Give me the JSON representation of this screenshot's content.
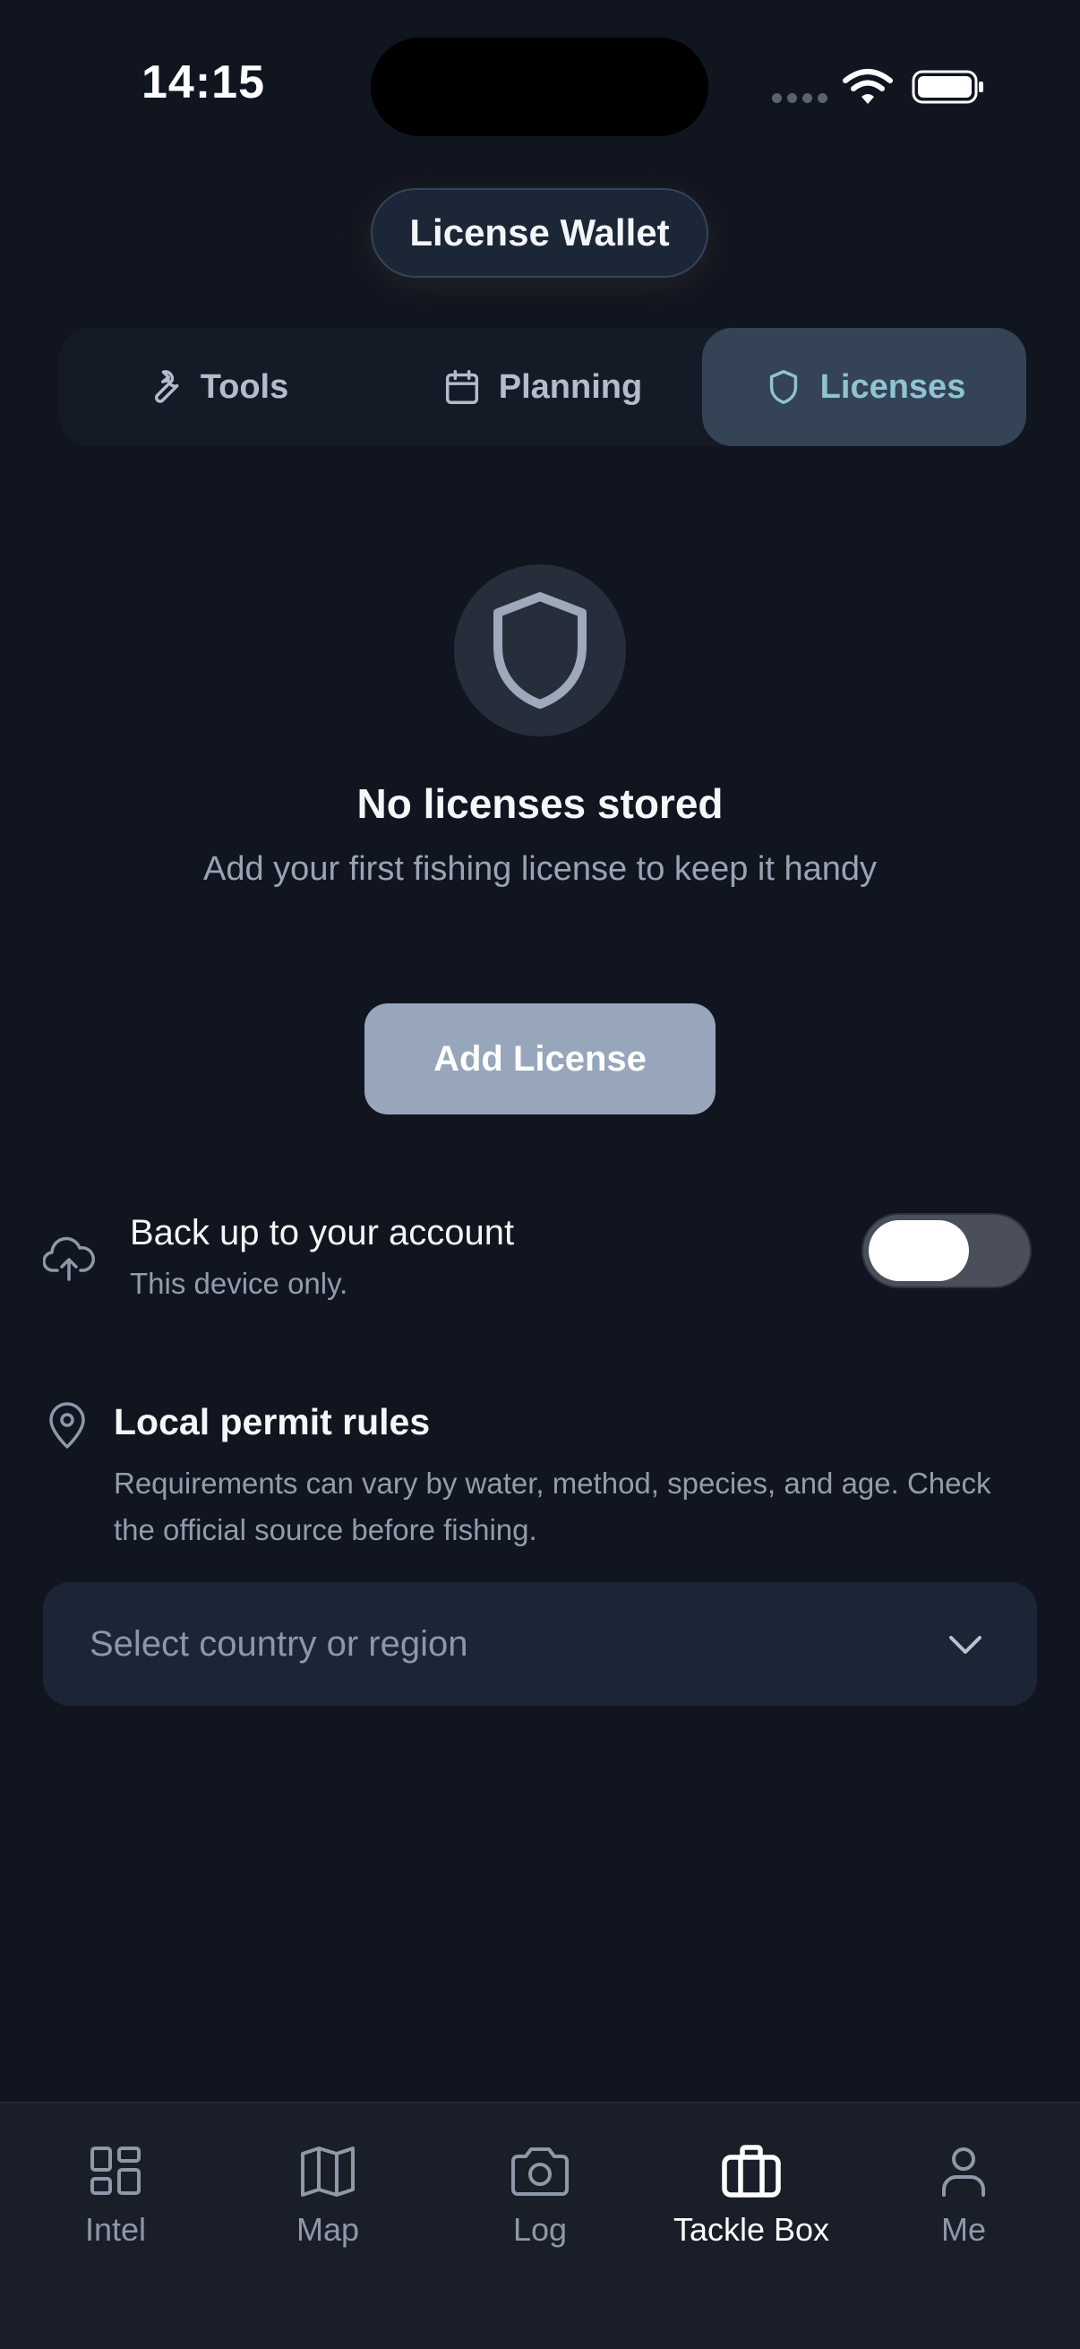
{
  "status_bar": {
    "time": "14:15"
  },
  "header": {
    "title": "License Wallet"
  },
  "tabs": [
    {
      "label": "Tools",
      "icon": "wrench-icon"
    },
    {
      "label": "Planning",
      "icon": "calendar-icon"
    },
    {
      "label": "Licenses",
      "icon": "shield-icon",
      "selected": true
    }
  ],
  "empty_state": {
    "icon": "shield-icon",
    "title": "No licenses stored",
    "subtitle": "Add your first fishing license to keep it handy",
    "button_label": "Add License"
  },
  "backup": {
    "icon": "cloud-upload-icon",
    "title": "Back up to your account",
    "subtitle": "This device only.",
    "enabled": false
  },
  "permit_rules": {
    "icon": "map-pin-icon",
    "title": "Local permit rules",
    "body": "Requirements can vary by water, method, species, and age. Check the official source before fishing.",
    "select_placeholder": "Select country or region"
  },
  "bottom_nav": [
    {
      "label": "Intel",
      "icon": "grid-icon"
    },
    {
      "label": "Map",
      "icon": "map-icon"
    },
    {
      "label": "Log",
      "icon": "camera-icon"
    },
    {
      "label": "Tackle Box",
      "icon": "briefcase-icon",
      "active": true
    },
    {
      "label": "Me",
      "icon": "person-icon"
    }
  ],
  "colors": {
    "background": "#111520",
    "accent_tab_text": "#8fc3d1",
    "selected_tab_bg": "#344356",
    "button_bg": "#97a6bb"
  }
}
